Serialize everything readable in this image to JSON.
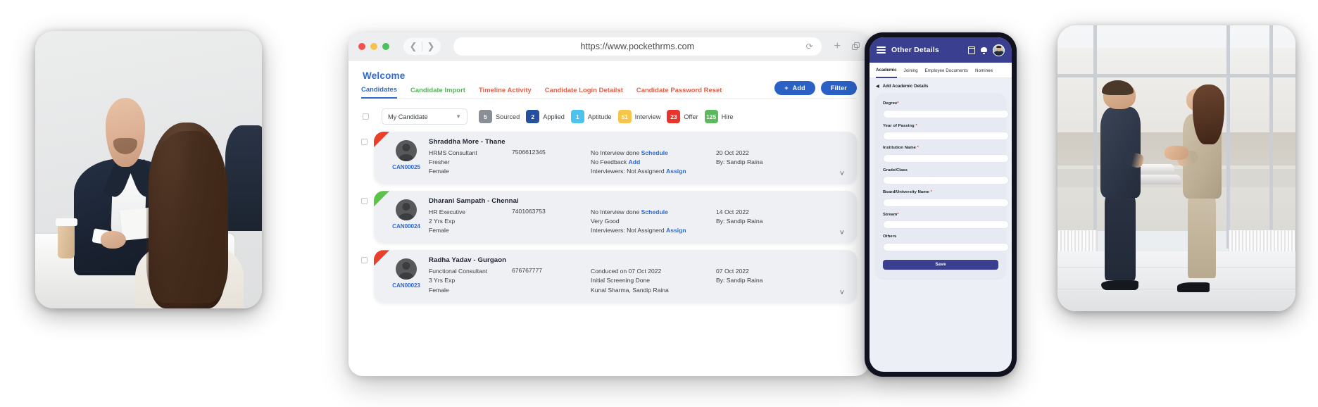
{
  "browser": {
    "url": "https://www.pockethrms.com",
    "window_dots": [
      "close",
      "minimize",
      "maximize"
    ],
    "back_icon": "chevron-left-icon",
    "forward_icon": "chevron-right-icon",
    "reload_icon": "reload-icon",
    "new_tab_icon": "plus-icon",
    "duplicate_icon": "copy-icon"
  },
  "page": {
    "title": "Welcome",
    "tabs": [
      {
        "label": "Candidates",
        "active": true
      },
      {
        "label": "Candidate Import",
        "active": false
      },
      {
        "label": "Timeline Activity",
        "active": false
      },
      {
        "label": "Candidate Login Detailst",
        "active": false
      },
      {
        "label": "Candidate Password Reset",
        "active": false
      }
    ],
    "actions": {
      "add_label": "Add",
      "add_icon": "plus-icon",
      "filter_label": "Filter"
    },
    "filter": {
      "select_value": "My Candidate",
      "chevron_icon": "chevron-down-icon",
      "pills": [
        {
          "count": "5",
          "label": "Sourced",
          "color": "#8a8f96"
        },
        {
          "count": "2",
          "label": "Applied",
          "color": "#24509e"
        },
        {
          "count": "1",
          "label": "Aptitude",
          "color": "#4cc3ee"
        },
        {
          "count": "51",
          "label": "Interview",
          "color": "#f7c54a"
        },
        {
          "count": "23",
          "label": "Offer",
          "color": "#e8342a"
        },
        {
          "count": "125",
          "label": "Hire",
          "color": "#5cb85c"
        }
      ]
    },
    "candidates": [
      {
        "id": "CAN00025",
        "name": "Shraddha More - Thane",
        "role": "HRMS Consultant",
        "experience": "Fresher",
        "gender": "Female",
        "phone": "7506612345",
        "interview_text": "No Interview done",
        "interview_link": "Schedule",
        "feedback_text": "No Feedback",
        "feedback_link": "Add",
        "interviewers_text": "Interviewers: Not Assignerd",
        "interviewers_link": "Assign",
        "date": "20 Oct 2022",
        "by": "By: Sandip Raina",
        "flag_color": "#e8402a",
        "expand_icon": "chevron-down-icon"
      },
      {
        "id": "CAN00024",
        "name": "Dharani Sampath - Chennai",
        "role": "HR Executive",
        "experience": "2 Yrs Exp",
        "gender": "Female",
        "phone": "7401063753",
        "interview_text": "No Interview done",
        "interview_link": "Schedule",
        "feedback_text": "Very Good",
        "feedback_link": "",
        "interviewers_text": "Interviewers: Not Assignerd",
        "interviewers_link": "Assign",
        "date": "14 Oct 2022",
        "by": "By: Sandip Raina",
        "flag_color": "#5bc24a",
        "expand_icon": "chevron-down-icon"
      },
      {
        "id": "CAN00023",
        "name": "Radha Yadav - Gurgaon",
        "role": "Functional Consultant",
        "experience": "3 Yrs Exp",
        "gender": "Female",
        "phone": "676767777",
        "interview_text": "Conduced on 07 Oct 2022",
        "interview_link": "",
        "feedback_text": "Initial Screening Done",
        "feedback_link": "",
        "interviewers_text": "Kunal Sharma, Sandip Raina",
        "interviewers_link": "",
        "date": "07 Oct 2022",
        "by": "By: Sandip Raina",
        "flag_color": "#e8402a",
        "expand_icon": "chevron-down-icon"
      }
    ]
  },
  "phone": {
    "header": {
      "menu_icon": "hamburger-icon",
      "title": "Other Details",
      "calendar_icon": "calendar-icon",
      "bell_icon": "bell-icon",
      "avatar": "user-avatar"
    },
    "tabs": [
      {
        "label": "Academic",
        "active": true
      },
      {
        "label": "Joining",
        "active": false
      },
      {
        "label": "Employee Documents",
        "active": false
      },
      {
        "label": "Nominee",
        "active": false
      }
    ],
    "section_title": "Add Academic Details",
    "section_caret": "caret-left-icon",
    "fields": [
      {
        "label": "Degree",
        "required": true,
        "value": ""
      },
      {
        "label": "Year of Passing",
        "required": true,
        "value": ""
      },
      {
        "label": "Institution Name",
        "required": true,
        "value": ""
      },
      {
        "label": "Grade/Class",
        "required": false,
        "value": ""
      },
      {
        "label": "Board/University Name",
        "required": true,
        "value": ""
      },
      {
        "label": "Stream",
        "required": true,
        "value": ""
      },
      {
        "label": "Others",
        "required": false,
        "value": ""
      }
    ],
    "save_label": "Save"
  },
  "photos": {
    "left_alt": "interview-photo",
    "right_alt": "handshake-photo"
  },
  "colors": {
    "primary_blue": "#2d6ad6",
    "button_blue": "#2b61c4",
    "phone_purple": "#3b3f8f",
    "card_bg": "#eef0f4"
  }
}
